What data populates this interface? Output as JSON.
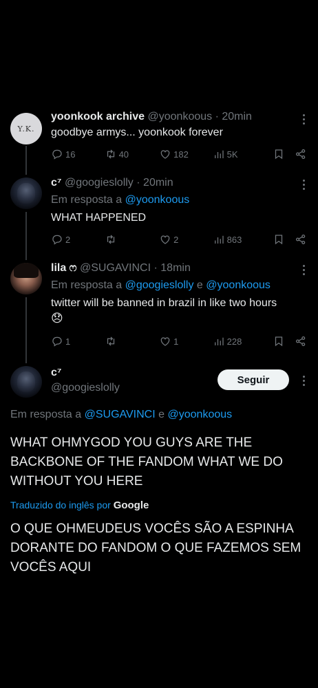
{
  "tweets": [
    {
      "name": "yoonkook archive",
      "handle": "@yoonkoous",
      "time": "· 20min",
      "avatar_text": "Y.K.",
      "text": "goodbye armys... yoonkook forever",
      "replies": "16",
      "retweets": "40",
      "likes": "182",
      "views": "5K"
    },
    {
      "name": "c⁷",
      "handle": "@googieslolly",
      "time": "· 20min",
      "reply_prefix": "Em resposta a",
      "reply_to": "@yoonkoous",
      "text": "WHAT HAPPENED",
      "replies": "2",
      "retweets": "",
      "likes": "2",
      "views": "863"
    },
    {
      "name": "lila ෆ",
      "handle": "@SUGAVINCI",
      "time": "· 18min",
      "reply_prefix": "Em resposta a",
      "reply_to_1": "@googieslolly",
      "reply_and": "e",
      "reply_to_2": "@yoonkoous",
      "text": "twitter will be banned in brazil in like two hours",
      "emoji": "😞",
      "replies": "1",
      "retweets": "",
      "likes": "1",
      "views": "228"
    }
  ],
  "focus": {
    "name": "c⁷",
    "handle": "@googieslolly",
    "follow_label": "Seguir",
    "reply_prefix": "Em resposta a",
    "reply_to_1": "@SUGAVINCI",
    "reply_and": "e",
    "reply_to_2": "@yoonkoous",
    "text": "WHAT OHMYGOD YOU GUYS ARE THE BACKBONE OF THE FANDOM WHAT WE DO WITHOUT YOU HERE",
    "translated_label": "Traduzido do inglês por",
    "translator": "Google",
    "translation": "O QUE OHMEUDEUS VOCÊS SÃO A ESPINHA DORANTE DO FANDOM O QUE FAZEMOS SEM VOCÊS AQUI"
  },
  "icons": [
    "reply-icon",
    "retweet-icon",
    "like-icon",
    "views-icon",
    "bookmark-icon",
    "share-icon",
    "more-icon"
  ],
  "colors": {
    "background": "#000000",
    "text": "#e7e9ea",
    "muted": "#71767b",
    "link": "#1d9bf0",
    "follow_bg": "#eff3f4"
  }
}
